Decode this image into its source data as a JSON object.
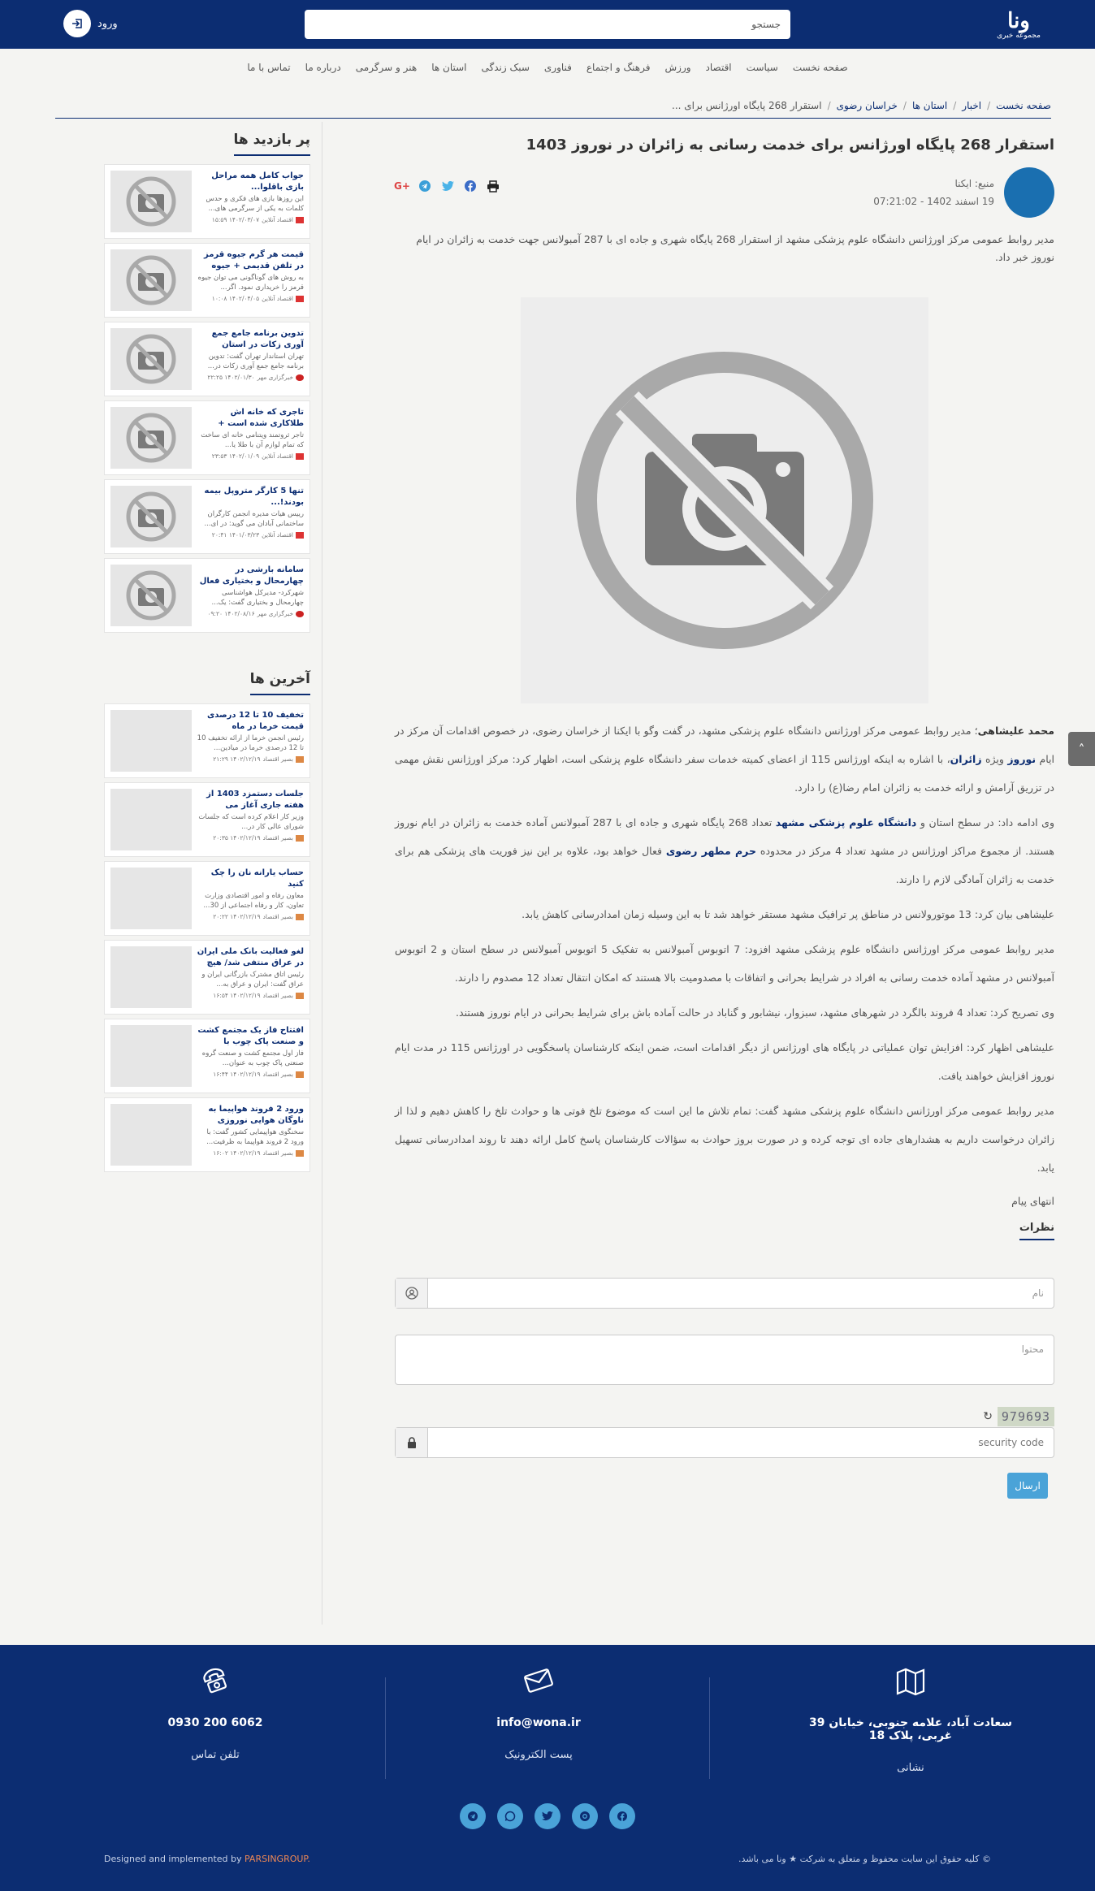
{
  "header": {
    "logo_mark": "ونا",
    "logo_sub": "مجموعه خبری",
    "search_placeholder": "جستجو",
    "login_label": "ورود"
  },
  "nav": [
    "صفحه نخست",
    "سیاست",
    "اقتصاد",
    "ورزش",
    "فرهنگ و اجتماع",
    "فناوری",
    "سبک زندگی",
    "استان ها",
    "هنر و سرگرمی",
    "درباره ما",
    "تماس با ما"
  ],
  "breadcrumb": {
    "home": "صفحه نخست",
    "items": [
      "اخبار",
      "استان ها",
      "خراسان رضوی"
    ],
    "current": "استقرار 268 پایگاه اورژانس برای ..."
  },
  "article": {
    "title": "استقرار 268 پایگاه اورژانس برای خدمت رسانی به زائران در نوروز 1403",
    "source": "منبع: ایکنا",
    "date": "19 اسفند 1402 - 07:21:02",
    "lead": "مدیر روابط عمومی مرکز اورژانس دانشگاه علوم پزشکی مشهد از استقرار 268 پایگاه شهری و جاده ای با 287 آمبولانس جهت خدمت به زائران در ایام نوروز خبر داد.",
    "p1_bold": "محمد علیشاهی",
    "p1_a": "؛ مدیر روابط عمومی مرکز اورژانس دانشگاه علوم پزشکی مشهد، در گفت وگو با ایکنا از خراسان رضوی، در خصوص اقدامات آن مرکز در ایام ",
    "p1_k1": "نوروز",
    "p1_b": " ویژه ",
    "p1_k2": "زائران",
    "p1_c": "، با اشاره به اینکه اورژانس 115 از اعضای کمیته خدمات سفر دانشگاه علوم پزشکی است، اظهار کرد: مرکز اورژانس نقش مهمی در تزریق آرامش و ارائه خدمت به زائران امام رضا(ع) را دارد.",
    "p2_a": "وی ادامه داد: در سطح استان و ",
    "p2_k1": "دانشگاه علوم پزشکی مشهد",
    "p2_b": " تعداد 268 پایگاه شهری و جاده ای با 287 آمبولانس آماده خدمت به زائران در ایام نوروز هستند. از مجموع مراکز اورژانس در مشهد تعداد 4 مرکز در محدوده ",
    "p2_k2": "حرم مطهر رضوی",
    "p2_c": " فعال خواهد بود، علاوه بر این نیز فوریت های پزشکی هم برای خدمت به زائران آمادگی لازم را دارند.",
    "p3": "علیشاهی بیان کرد: 13 موتورولانس در مناطق پر ترافیک مشهد مستقر خواهد شد تا به این وسیله زمان امدادرسانی کاهش یابد.",
    "p4": "مدیر روابط عمومی مرکز اورژانس دانشگاه علوم پزشکی مشهد افزود: 7 اتوبوس آمبولانس به تفکیک 5 اتوبوس آمبولانس در سطح استان و 2 اتوبوس آمبولانس در مشهد آماده خدمت رسانی به افراد در شرایط بحرانی و اتفاقات با مصدومیت بالا هستند که امکان انتقال تعداد 12 مصدوم را دارند.",
    "p5": "وی تصریح کرد: تعداد 4 فروند بالگرد در شهرهای مشهد، سبزوار، نیشابور و گناباد در حالت آماده باش برای شرایط بحرانی در ایام نوروز هستند.",
    "p6": "علیشاهی اظهار کرد: افزایش توان عملیاتی در پایگاه های اورژانس از دیگر اقدامات است، ضمن اینکه کارشناسان پاسخگویی در اورژانس 115 در مدت ایام نوروز افزایش خواهند یافت.",
    "p7": "مدیر روابط عمومی مرکز اورژانس دانشگاه علوم پزشکی مشهد گفت: تمام تلاش ما این است که موضوع تلخ فوتی ها و حوادث تلخ را کاهش دهیم و لذا از زائران درخواست داریم به هشدارهای جاده ای توجه کرده و در صورت بروز حوادث به سؤالات کارشناسان پاسخ کامل ارائه دهند تا روند امدادرسانی تسهیل یابد.",
    "end": "انتهای پیام"
  },
  "comments": {
    "title": "نظرات",
    "name_placeholder": "نام",
    "content_placeholder": "محتوا",
    "captcha_text": "979693",
    "security_placeholder": "security code",
    "submit_label": "ارسال"
  },
  "most_viewed": {
    "title": "پر بازدید ها",
    "items": [
      {
        "title": "جواب کامل همه مراحل بازی باقلوا...",
        "desc": "این روزها بازی های فکری و حدس کلمات به یکی از سرگرمی های...",
        "source": "اقتصاد آنلاین",
        "time": "۱۴۰۲/۰۳/۰۷ ۱۵:۵۹"
      },
      {
        "title": "قیمت هر گرم جیوه قرمز در تلفن قدیمی + جیوه قرمز در...",
        "desc": "به روش های گوناگونی می توان جیوه قرمز را خریداری نمود. اگر...",
        "source": "اقتصاد آنلاین",
        "time": "۱۴۰۲/۰۴/۰۵ ۱۰:۰۸"
      },
      {
        "title": "تدوین برنامه جامع جمع آوری زکات در استان تهران ضرور...",
        "desc": "تهران استاندار تهران گفت: تدوین برنامه جامع جمع آوری زکات در...",
        "source": "خبرگزاری مهر",
        "time": "۱۴۰۲/۰۱/۳۰ ۲۲:۲۵"
      },
      {
        "title": "تاجری که خانه اش طلاکاری شده است + عکس...",
        "desc": "تاجر ثروتمند ویتنامی خانه ای ساخت که تمام لوازم آن با طلا یا...",
        "source": "اقتصاد آنلاین",
        "time": "۱۴۰۲/۰۱/۰۹ ۲۳:۵۳"
      },
      {
        "title": "تنها 5 کارگر متروپل بیمه بودند!...",
        "desc": "رییس هیات مدیره انجمن کارگران ساختمانی آبادان می گوید: در ای...",
        "source": "اقتصاد آنلاین",
        "time": "۱۴۰۱/۰۳/۲۳ ۲۰:۴۱"
      },
      {
        "title": "سامانه بارشی در چهارمحال و بختیاری فعال شد...",
        "desc": "شهرکرد- مدیرکل هواشناسی چهارمحال و بختیاری گفت: یک...",
        "source": "خبرگزاری مهر",
        "time": "۱۴۰۲/۰۸/۱۶ ۰۹:۲۰"
      }
    ]
  },
  "latest": {
    "title": "آخرین ها",
    "items": [
      {
        "title": "تخفیف 10 تا 12 درصدی قیمت خرما در ماه رمضان...",
        "desc": "رئیس انجمن خرما از ارائه تخفیف 10 تا 12 درصدی خرما در میادین...",
        "source": "بصیر اقتصاد",
        "time": "۱۴۰۲/۱۲/۱۹ ۲۱:۲۹"
      },
      {
        "title": "جلسات دستمزد 1403 از هفته جاری آغاز می شود...",
        "desc": "وزیر کار اعلام کرده است که جلسات شورای عالی کار در...",
        "source": "بصیر اقتصاد",
        "time": "۱۴۰۲/۱۲/۱۹ ۲۰:۳۵"
      },
      {
        "title": "حساب یارانه نان را چک کنید",
        "desc": "معاون رفاه و امور اقتصادی وزارت تعاون، کار و رفاه اجتماعی از 30...",
        "source": "بصیر اقتصاد",
        "time": "۱۴۰۲/۱۲/۱۹ ۲۰:۲۲"
      },
      {
        "title": "لغو فعالیت بانک ملی ایران در عراق منتفی شد/ هیچ مشکل...",
        "desc": "رئیس اتاق مشترک بازرگانی ایران و عراق گفت: ایران و عراق به...",
        "source": "بصیر اقتصاد",
        "time": "۱۴۰۲/۱۲/۱۹ ۱۶:۵۴"
      },
      {
        "title": "افتتاح فاز یک مجتمع کشت و صنعت پاک چوب با حمایت...",
        "desc": "فاز اول مجتمع کشت و صنعت گروه صنعتی پاک چوب به عنوان...",
        "source": "بصیر اقتصاد",
        "time": "۱۴۰۲/۱۲/۱۹ ۱۶:۴۴"
      },
      {
        "title": "ورود 2 فروند هواپیما به ناوگان هوایی نوروزی کشور...",
        "desc": "سخنگوی هواپیمایی کشور گفت: با ورود 2 فروند هواپیما به ظرفیت...",
        "source": "بصیر اقتصاد",
        "time": "۱۴۰۲/۱۲/۱۹ ۱۶:۰۲"
      }
    ]
  },
  "footer": {
    "address_value": "سعادت آباد، علامه جنوبی، خیابان 39 غربی، پلاک 18",
    "address_label": "نشانی",
    "email_value": "info@wona.ir",
    "email_label": "پست الکترونیک",
    "phone_value": "0930 200 6062",
    "phone_label": "تلفن تماس",
    "copyright": "© کلیه حقوق این سایت محفوظ و متعلق به شرکت ★ ونا می باشد.",
    "impl_prefix": "Designed and implemented by ",
    "impl_brand": "PARSINGROUP."
  },
  "colors": {
    "primary": "#0c2d72",
    "accent": "#4aa3d8"
  }
}
